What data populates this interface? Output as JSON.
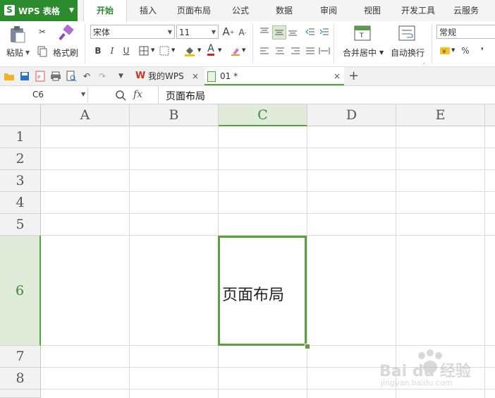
{
  "app": {
    "title": "WPS 表格",
    "logo_letter": "S"
  },
  "menu_tabs": [
    "开始",
    "插入",
    "页面布局",
    "公式",
    "数据",
    "审阅",
    "视图",
    "开发工具",
    "云服务"
  ],
  "active_tab": "开始",
  "ribbon": {
    "paste": "粘贴",
    "format_painter": "格式刷",
    "font_name": "宋体",
    "font_size": "11",
    "bold": "B",
    "italic": "I",
    "underline": "U",
    "merge_center": "合并居中",
    "wrap_text": "自动换行",
    "number_format": "常规",
    "percent": "%",
    "comma": "❜"
  },
  "doc_tabs": [
    {
      "label": "我的WPS",
      "icon": "wps-icon"
    },
    {
      "label": "01 *",
      "icon": "sheet-doc-icon"
    }
  ],
  "formula_bar": {
    "cell_ref": "C6",
    "fx": "fx",
    "content": "页面布局"
  },
  "columns": [
    "A",
    "B",
    "C",
    "D",
    "E"
  ],
  "rows": [
    "1",
    "2",
    "3",
    "4",
    "5",
    "6",
    "7",
    "8"
  ],
  "selected": {
    "column": "C",
    "row": "6",
    "value": "页面布局"
  },
  "watermark": {
    "brand": "Bai du 经验",
    "url": "jingyan.baidu.com"
  },
  "colors": {
    "accent": "#2c8b2c",
    "selection": "#5aa13c",
    "header_bg": "#f2f2f2"
  }
}
